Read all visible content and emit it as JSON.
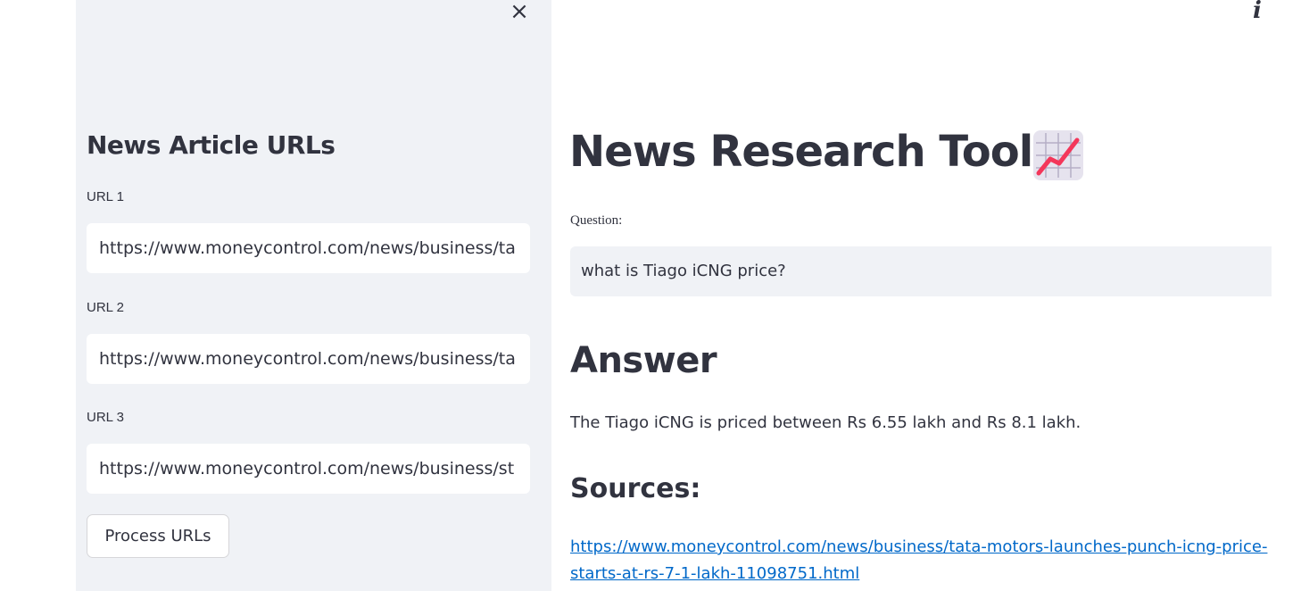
{
  "sidebar": {
    "close_glyph": "×",
    "heading": "News Article URLs",
    "urls": [
      {
        "label": "URL 1",
        "value": "https://www.moneycontrol.com/news/business/ta"
      },
      {
        "label": "URL 2",
        "value": "https://www.moneycontrol.com/news/business/ta"
      },
      {
        "label": "URL 3",
        "value": "https://www.moneycontrol.com/news/business/st"
      }
    ],
    "process_button": "Process URLs"
  },
  "header": {
    "info_glyph": "i"
  },
  "main": {
    "title": "News Research Tool",
    "title_icon": "chart-increasing-icon",
    "question_label": "Question:",
    "question_value": "what is Tiago iCNG price?",
    "answer_heading": "Answer",
    "answer_text": "The Tiago iCNG is priced between Rs 6.55 lakh and Rs 8.1 lakh.",
    "sources_heading": "Sources:",
    "source_link": "https://www.moneycontrol.com/news/business/tata-motors-launches-punch-icng-price-starts-at-rs-7-1-lakh-11098751.html"
  },
  "colors": {
    "sidebar_bg": "#f0f2f6",
    "text": "#31333f",
    "link": "#0068c9"
  }
}
